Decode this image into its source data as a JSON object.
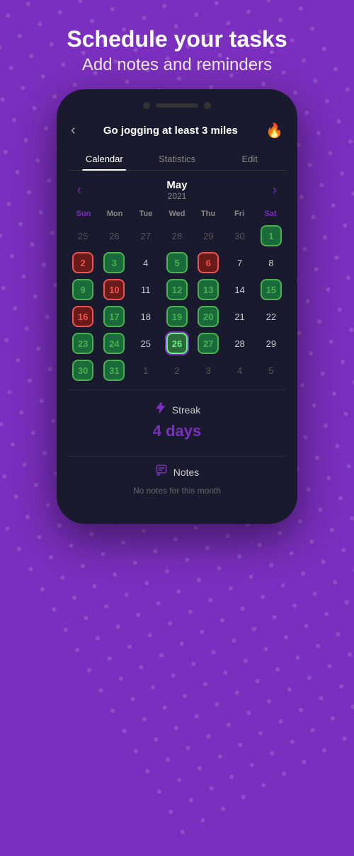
{
  "hero": {
    "title": "Schedule your tasks",
    "subtitle": "Add notes and reminders"
  },
  "phone": {
    "screen_title": "Go jogging at least 3 miles",
    "tabs": [
      {
        "label": "Calendar",
        "active": true
      },
      {
        "label": "Statistics",
        "active": false
      },
      {
        "label": "Edit",
        "active": false
      }
    ],
    "calendar": {
      "month": "May",
      "year": "2021",
      "day_headers": [
        "Sun",
        "Mon",
        "Tue",
        "Wed",
        "Thu",
        "Fri",
        "Sat"
      ],
      "rows": [
        [
          {
            "day": "25",
            "type": "other"
          },
          {
            "day": "26",
            "type": "other"
          },
          {
            "day": "27",
            "type": "other"
          },
          {
            "day": "28",
            "type": "other"
          },
          {
            "day": "29",
            "type": "other"
          },
          {
            "day": "30",
            "type": "other"
          },
          {
            "day": "1",
            "type": "green"
          }
        ],
        [
          {
            "day": "2",
            "type": "red"
          },
          {
            "day": "3",
            "type": "green"
          },
          {
            "day": "4",
            "type": "plain"
          },
          {
            "day": "5",
            "type": "green"
          },
          {
            "day": "6",
            "type": "red"
          },
          {
            "day": "7",
            "type": "plain"
          },
          {
            "day": "8",
            "type": "plain"
          }
        ],
        [
          {
            "day": "9",
            "type": "green"
          },
          {
            "day": "10",
            "type": "red"
          },
          {
            "day": "11",
            "type": "plain"
          },
          {
            "day": "12",
            "type": "green"
          },
          {
            "day": "13",
            "type": "green"
          },
          {
            "day": "14",
            "type": "plain"
          },
          {
            "day": "15",
            "type": "green"
          }
        ],
        [
          {
            "day": "16",
            "type": "red"
          },
          {
            "day": "17",
            "type": "green"
          },
          {
            "day": "18",
            "type": "plain"
          },
          {
            "day": "19",
            "type": "green"
          },
          {
            "day": "20",
            "type": "green"
          },
          {
            "day": "21",
            "type": "plain"
          },
          {
            "day": "22",
            "type": "plain"
          }
        ],
        [
          {
            "day": "23",
            "type": "green"
          },
          {
            "day": "24",
            "type": "green"
          },
          {
            "day": "25",
            "type": "plain"
          },
          {
            "day": "26",
            "type": "green_highlight"
          },
          {
            "day": "27",
            "type": "green"
          },
          {
            "day": "28",
            "type": "plain"
          },
          {
            "day": "29",
            "type": "plain"
          }
        ],
        [
          {
            "day": "30",
            "type": "green"
          },
          {
            "day": "31",
            "type": "green"
          },
          {
            "day": "1",
            "type": "other"
          },
          {
            "day": "2",
            "type": "other"
          },
          {
            "day": "3",
            "type": "other"
          },
          {
            "day": "4",
            "type": "other"
          },
          {
            "day": "5",
            "type": "other"
          }
        ]
      ]
    },
    "streak": {
      "label": "Streak",
      "value": "4 days"
    },
    "notes": {
      "label": "Notes",
      "empty_text": "No notes for this month"
    }
  }
}
